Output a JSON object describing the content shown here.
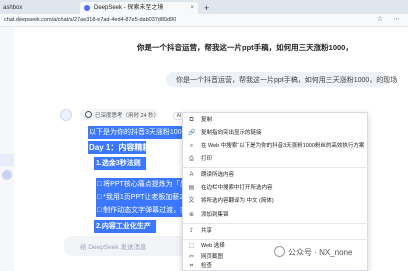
{
  "browser": {
    "prev_tab": "ashbox",
    "active_tab": "DeepSeek - 探索未至之境",
    "tab_close": "×",
    "tab_add": "+",
    "url": "chat.deepseek.com/a/chat/s/27ae318-e7ad-4ed4-87e5-dab037d80d90",
    "right_icons": "☆ ⋯"
  },
  "chat": {
    "question_1": "你是一个抖音运营，帮我这一片ppt手稿，如何用三天涨粉1000，",
    "question_2": "你是一个抖音运营，帮我这一片ppt手稿，如何用三天涨粉1000，的现场",
    "thought_label": "已深度思考（用时 24 秒）",
    "thought_toggle": "⌄",
    "answer_lines": [
      "以下是为你的抖音3天涨粉1000",
      "Day 1：内容精耕准备",
      "1.选金3秒法则",
      "□ 将PPT核心痛点提炼为「反常识",
      "□ *我用1页PPT让老板加薪20%*",
      "□ 制作动态文字弹幕过渡，突出",
      "2.内容工业化生产"
    ],
    "composer_placeholder": "给 DeepSeek 发送消息",
    "ai_floater": "AI"
  },
  "context_menu": {
    "items": [
      {
        "icon": "copy-icon",
        "glyph": "⧉",
        "label": "复制"
      },
      {
        "icon": "link-icon",
        "glyph": "🔗",
        "label": "复制指向突出显示的链接"
      },
      {
        "icon": "search-icon",
        "glyph": "⌕",
        "label": "在 Web 中搜索“以下是为你的抖音3天涨粉1000粉丝的高效执行方案，分阶段拆解核心...”"
      },
      {
        "icon": "print-icon",
        "glyph": "⎙",
        "label": "打印"
      },
      {
        "icon": "read-aloud-icon",
        "glyph": "A",
        "label": "朗读所选内容"
      },
      {
        "icon": "sidebar-icon",
        "glyph": "▤",
        "label": "在边栏中搜索中打开所选内容"
      },
      {
        "icon": "translate-icon",
        "glyph": "文",
        "label": "将所选内容翻译为 中文 (简体)"
      },
      {
        "icon": "collection-icon",
        "glyph": "⊕",
        "label": "添加到集锦"
      },
      {
        "icon": "share-icon",
        "glyph": "⇪",
        "label": "共享"
      },
      {
        "icon": "web-select-icon",
        "glyph": "⬚",
        "label": "Web 选择"
      },
      {
        "icon": "screenshot-icon",
        "glyph": "✂",
        "label": "网页截图"
      },
      {
        "icon": "inspect-icon",
        "glyph": "⌗",
        "label": "检查"
      }
    ]
  },
  "watermark": {
    "text": "公众号 · NX_none"
  }
}
